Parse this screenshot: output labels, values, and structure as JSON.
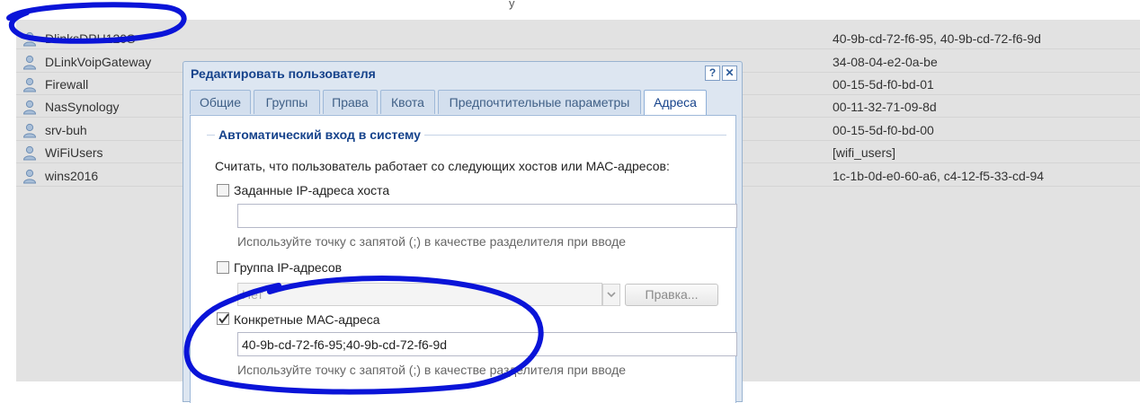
{
  "grid": {
    "top_partial_text": "y",
    "rows": [
      {
        "name": "DlinksDPH120S",
        "mac": "40-9b-cd-72-f6-95, 40-9b-cd-72-f6-9d"
      },
      {
        "name": "DLinkVoipGateway",
        "mac": "34-08-04-e2-0a-be"
      },
      {
        "name": "Firewall",
        "mac": "00-15-5d-f0-bd-01"
      },
      {
        "name": "NasSynology",
        "mac": "00-11-32-71-09-8d"
      },
      {
        "name": "srv-buh",
        "mac": "00-15-5d-f0-bd-00"
      },
      {
        "name": "WiFiUsers",
        "mac": "[wifi_users]"
      },
      {
        "name": "wins2016",
        "mac": "1c-1b-0d-e0-60-a6, c4-12-f5-33-cd-94"
      }
    ]
  },
  "dialog": {
    "title": "Редактировать пользователя",
    "help_label": "?",
    "close_label": "✕",
    "tabs": [
      {
        "label": "Общие"
      },
      {
        "label": "Группы"
      },
      {
        "label": "Права"
      },
      {
        "label": "Квота"
      },
      {
        "label": "Предпочтительные параметры"
      },
      {
        "label": "Адреса"
      }
    ],
    "active_tab": "Адреса",
    "section_title": "Автоматический вход в систему",
    "intro": "Считать, что пользователь работает со следующих хостов или МАС-адресов:",
    "ip_hosts": {
      "label": "Заданные IP-адреса хоста",
      "checked": false,
      "value": "",
      "hint": "Используйте точку с запятой (;) в качестве разделителя при вводе"
    },
    "ip_group": {
      "label": "Группа IP-адресов",
      "checked": false,
      "selected": "Нет",
      "edit_button": "Правка..."
    },
    "mac": {
      "label": "Конкретные МАС-адреса",
      "checked": true,
      "value": "40-9b-cd-72-f6-95;40-9b-cd-72-f6-9d",
      "hint": "Используйте точку с запятой (;) в качестве разделителя при вводе"
    }
  },
  "colors": {
    "annotation": "#0a14d8",
    "dialog_title": "#15428b",
    "grid_bg": "#e2e2e2"
  }
}
